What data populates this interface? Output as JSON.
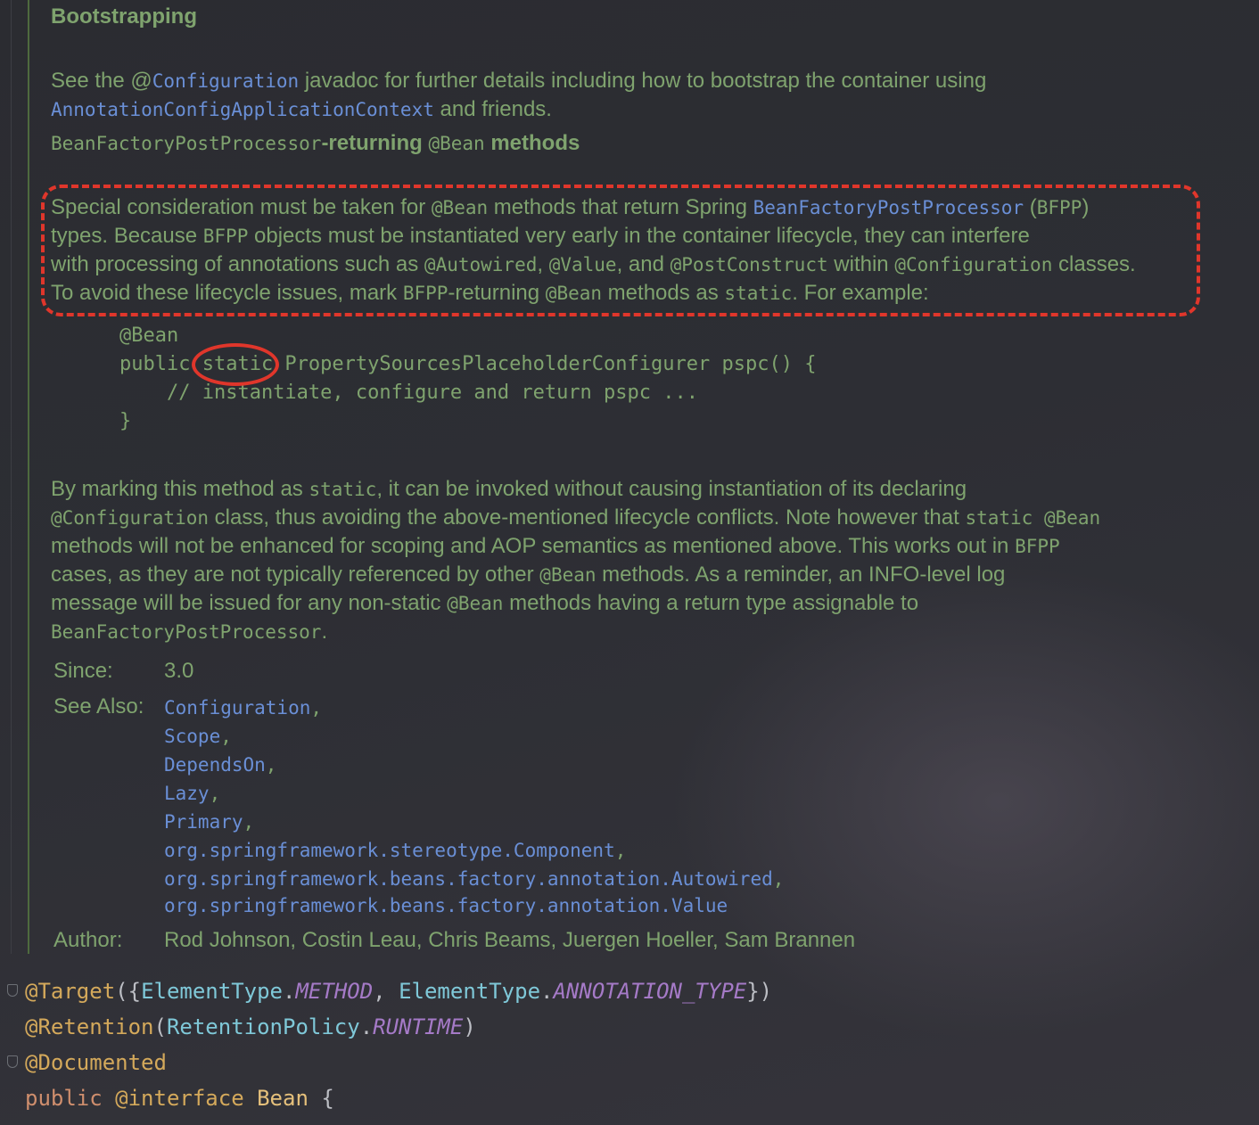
{
  "doc": {
    "section_title": "Bootstrapping",
    "p1": {
      "t1": "See the ",
      "at": "@",
      "link1": "Configuration",
      "t2": " javadoc for further details including how to bootstrap the container using",
      "link2": "AnnotationConfigApplicationContext",
      "t3": " and friends."
    },
    "heading2": {
      "code1": "BeanFactoryPostProcessor",
      "t1": "-returning ",
      "code2": "@Bean",
      "t2": " methods"
    },
    "p2": {
      "l1a": "Special consideration must be taken for ",
      "l1b": "@Bean",
      "l1c": " methods that return Spring ",
      "l1d": "BeanFactoryPostProcessor",
      "l1e": " (",
      "l1f": "BFPP",
      "l1g": ")",
      "l2a": "types. Because ",
      "l2b": "BFPP",
      "l2c": " objects must be instantiated very early in the container lifecycle, they can interfere",
      "l3a": "with processing of annotations such as ",
      "l3b": "@Autowired",
      "l3c": ", ",
      "l3d": "@Value",
      "l3e": ", and ",
      "l3f": "@PostConstruct",
      "l3g": " within ",
      "l3h": "@Configuration",
      "l3i": " classes.",
      "l4a": "To avoid these lifecycle issues, mark ",
      "l4b": "BFPP",
      "l4c": "-returning ",
      "l4d": "@Bean",
      "l4e": " methods as ",
      "l4f": "static",
      "l4g": ". For example:"
    },
    "example_code": [
      "@Bean",
      "public static PropertySourcesPlaceholderConfigurer pspc() {",
      "    // instantiate, configure and return pspc ...",
      "}"
    ],
    "p3": {
      "l1a": "By marking this method as ",
      "l1b": "static",
      "l1c": ", it can be invoked without causing instantiation of its declaring",
      "l2a": "@Configuration",
      "l2b": " class, thus avoiding the above-mentioned lifecycle conflicts. Note however that ",
      "l2c": "static @Bean",
      "l3a": "methods will not be enhanced for scoping and AOP semantics as mentioned above. This works out in ",
      "l3b": "BFPP",
      "l4a": "cases, as they are not typically referenced by other ",
      "l4b": "@Bean",
      "l4c": " methods. As a reminder, an INFO-level log",
      "l5a": "message will be issued for any non-static ",
      "l5b": "@Bean",
      "l5c": " methods having a return type assignable to",
      "l6a": "BeanFactoryPostProcessor",
      "l6b": "."
    },
    "since_label": "Since:",
    "since_value": "3.0",
    "see_also_label": "See Also:",
    "see_also": [
      {
        "text": "Configuration",
        "sep": ","
      },
      {
        "text": "Scope",
        "sep": ","
      },
      {
        "text": "DependsOn",
        "sep": ","
      },
      {
        "text": "Lazy",
        "sep": ","
      },
      {
        "text": "Primary",
        "sep": ","
      },
      {
        "text": "org.springframework.stereotype.Component",
        "sep": ","
      },
      {
        "text": "org.springframework.beans.factory.annotation.Autowired",
        "sep": ","
      },
      {
        "text": "org.springframework.beans.factory.annotation.Value",
        "sep": ""
      }
    ],
    "author_label": "Author:",
    "author_value": "Rod Johnson, Costin Leau, Chris Beams, Juergen Hoeller, Sam Brannen"
  },
  "source": {
    "line1": {
      "a": "@Target",
      "b": "({",
      "c": "ElementType",
      "d": ".",
      "e": "METHOD",
      "f": ", ",
      "g": "ElementType",
      "h": ".",
      "i": "ANNOTATION_TYPE",
      "j": "})"
    },
    "line2": {
      "a": "@Retention",
      "b": "(",
      "c": "RetentionPolicy",
      "d": ".",
      "e": "RUNTIME",
      "f": ")"
    },
    "line3": {
      "a": "@Documented"
    },
    "line4": {
      "a": "public",
      "b": " ",
      "c": "@interface",
      "d": " ",
      "e": "Bean",
      "f": " {"
    }
  },
  "colors": {
    "doc_text": "#7fa36e",
    "doc_link": "#6a8fd6",
    "annotation_highlight": "#e0362b",
    "editor_background": "#2a2b30"
  }
}
